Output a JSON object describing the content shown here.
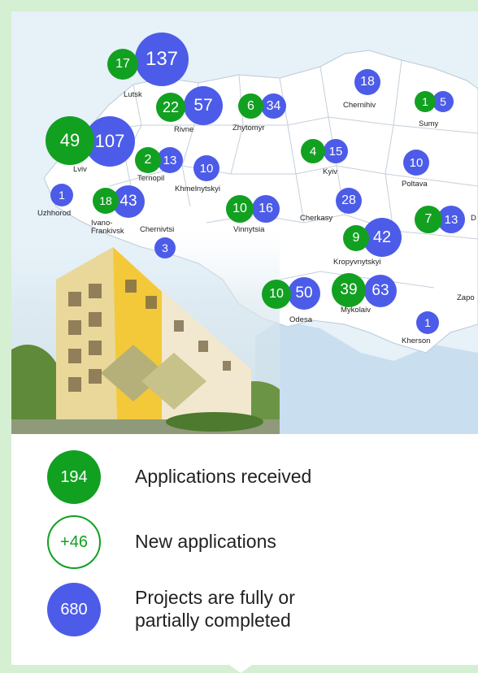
{
  "map": {
    "regions": [
      {
        "key": "lutsk",
        "label": "Lutsk"
      },
      {
        "key": "rivne",
        "label": "Rivne"
      },
      {
        "key": "zhytomyr",
        "label": "Zhytomyr"
      },
      {
        "key": "chernihiv",
        "label": "Chernihiv"
      },
      {
        "key": "sumy",
        "label": "Sumy"
      },
      {
        "key": "lviv",
        "label": "Lviv"
      },
      {
        "key": "ternopil",
        "label": "Ternopil"
      },
      {
        "key": "khmelnytskyi",
        "label": "Khmelnytskyi"
      },
      {
        "key": "kyiv",
        "label": "Kyiv"
      },
      {
        "key": "poltava",
        "label": "Poltava"
      },
      {
        "key": "uzhhorod",
        "label": "Uzhhorod"
      },
      {
        "key": "ivano",
        "label": "Ivano-\nFrankivsk"
      },
      {
        "key": "chernivtsi",
        "label": "Chernivtsi"
      },
      {
        "key": "vinnytsia",
        "label": "Vinnytsia"
      },
      {
        "key": "cherkasy",
        "label": "Cherkasy"
      },
      {
        "key": "kropyvnytskyi",
        "label": "Kropyvnytskyi"
      },
      {
        "key": "dnipro",
        "label": "D"
      },
      {
        "key": "odesa",
        "label": "Odesa"
      },
      {
        "key": "mykolaiv",
        "label": "Mykolaiv"
      },
      {
        "key": "kherson",
        "label": "Kherson"
      },
      {
        "key": "zaporizhzhia",
        "label": "Zapo"
      }
    ],
    "badges": {
      "lutsk_new": "17",
      "lutsk_done": "137",
      "rivne_new": "22",
      "rivne_done": "57",
      "zhytomyr_new": "6",
      "zhytomyr_done": "34",
      "chernihiv_done": "18",
      "sumy_new": "1",
      "sumy_done": "5",
      "lviv_new": "49",
      "lviv_done": "107",
      "ternopil_new": "2",
      "ternopil_done": "13",
      "khmelnytskyi_done": "10",
      "kyiv_new": "4",
      "kyiv_done": "15",
      "poltava_done": "10",
      "uzhhorod_done": "1",
      "ivano_new": "18",
      "ivano_done": "43",
      "chernivtsi_done": "3",
      "vinnytsia_new": "10",
      "vinnytsia_done": "16",
      "cherkasy_done": "28",
      "kropyvnytskyi_new": "9",
      "kropyvnytskyi_done": "42",
      "dnipro_new": "7",
      "dnipro_done": "13",
      "odesa_new": "10",
      "odesa_done": "50",
      "mykolaiv_new": "39",
      "mykolaiv_done": "63",
      "kherson_done": "1"
    }
  },
  "legend": {
    "received_value": "194",
    "received_label": "Applications received",
    "new_value": "+46",
    "new_label": "New applications",
    "completed_value": "680",
    "completed_label": "Projects are fully or\npartially completed"
  },
  "colors": {
    "green": "#12a021",
    "blue": "#4c5ce8",
    "background": "#d5efd2"
  }
}
